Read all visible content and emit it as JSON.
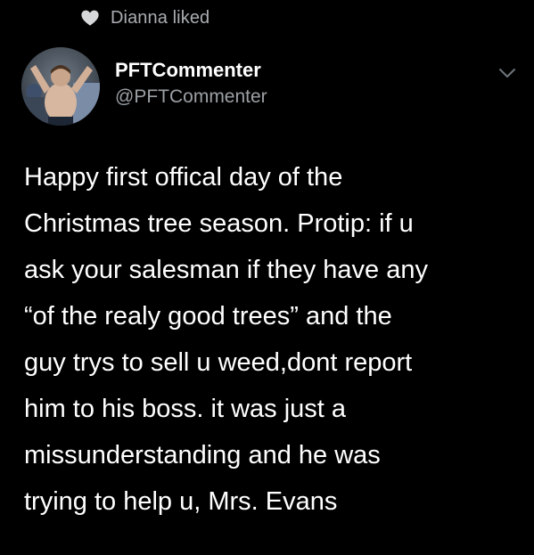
{
  "social_context": {
    "text": "Dianna liked",
    "icon": "heart-icon"
  },
  "author": {
    "display_name": "PFTCommenter",
    "handle": "@PFTCommenter",
    "avatar_icon": "avatar"
  },
  "tweet": {
    "lines": [
      "Happy first offical day of the",
      "Christmas tree season. Protip: if u",
      "ask your salesman if they have any",
      "“of the realy good trees” and the",
      "guy trys to sell u weed,dont report",
      "him to his boss. it was just a",
      "missunderstanding and he was",
      "trying to help u, Mrs. Evans"
    ]
  },
  "menu": {
    "icon": "chevron-down-icon"
  },
  "colors": {
    "background": "#000000",
    "primary_text": "#ffffff",
    "secondary_text": "#9ba0a5"
  }
}
